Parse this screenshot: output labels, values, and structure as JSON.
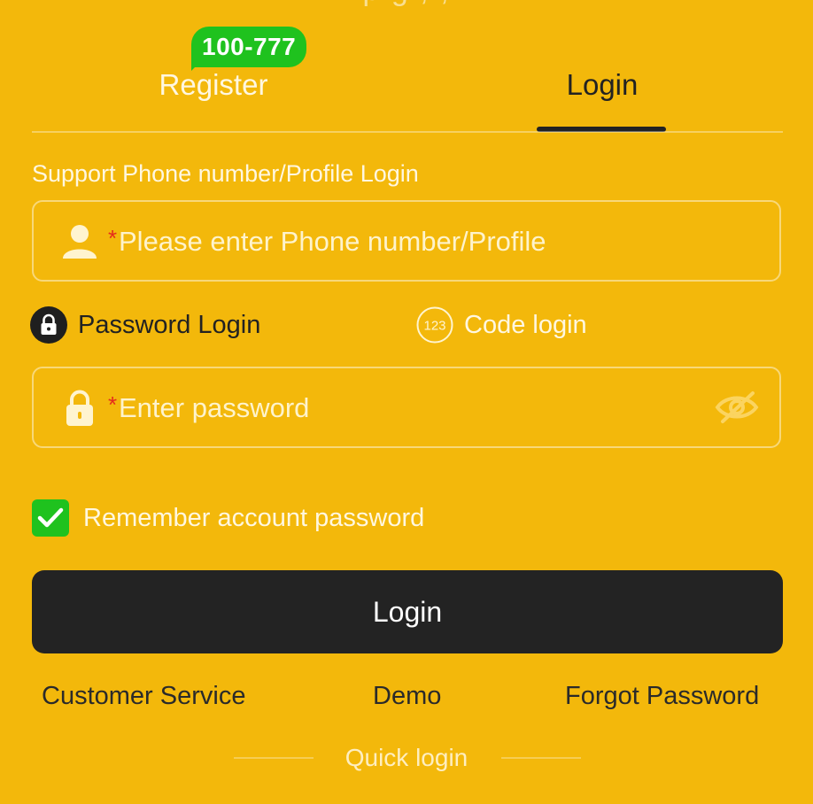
{
  "top_cropped_text": "p                    g               ,  ,   ",
  "tabs": {
    "register_label": "Register",
    "register_badge": "100-777",
    "login_label": "Login"
  },
  "support_text": "Support Phone number/Profile Login",
  "phone_field": {
    "required_mark": "*",
    "placeholder": "Please enter Phone number/Profile"
  },
  "login_modes": {
    "password_label": "Password Login",
    "code_label": "Code login",
    "code_icon_text": "123"
  },
  "password_field": {
    "required_mark": "*",
    "placeholder": "Enter password"
  },
  "remember_label": "Remember account password",
  "login_button_label": "Login",
  "links": {
    "customer_service": "Customer Service",
    "demo": "Demo",
    "forgot_password": "Forgot Password"
  },
  "quick_login_label": "Quick login",
  "colors": {
    "background": "#f3b80b",
    "badge": "#1fc21e",
    "button": "#232323",
    "required": "#e52b1d"
  }
}
